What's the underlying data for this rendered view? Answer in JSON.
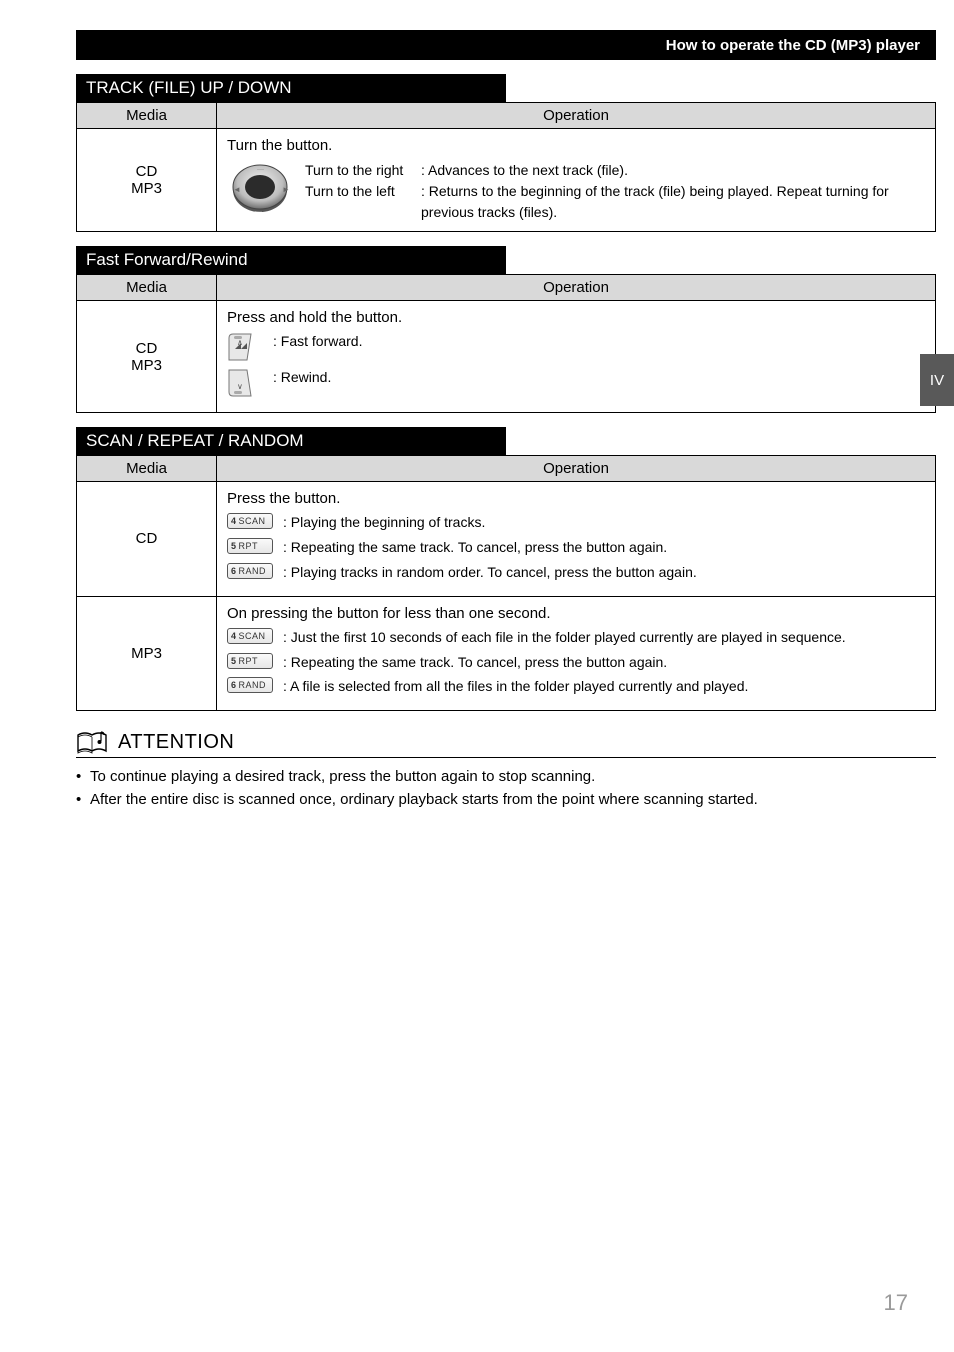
{
  "sideTab": "IV",
  "header": {
    "title": "How to operate the CD (MP3) player"
  },
  "section1": {
    "title": "TRACK (FILE) UP / DOWN",
    "mediaHeader": "Media",
    "opHeader": "Operation",
    "media1": "CD",
    "media2": "MP3",
    "lead": "Turn the button.",
    "rightLbl": "Turn to the right",
    "rightTxt": ": Advances to the next track (file).",
    "leftLbl": "Turn to the left",
    "leftTxt": ": Returns to the beginning of the track (file) being played. Repeat turning for previous tracks (files)."
  },
  "section2": {
    "title": "Fast Forward/Rewind",
    "mediaHeader": "Media",
    "opHeader": "Operation",
    "media1": "CD",
    "media2": "MP3",
    "lead": "Press and hold the button.",
    "ffTxt": ": Fast forward.",
    "rwTxt": ": Rewind."
  },
  "section3": {
    "title": "SCAN / REPEAT / RANDOM",
    "mediaHeader": "Media",
    "opHeader": "Operation",
    "cdMedia": "CD",
    "cdLead": "Press the button.",
    "cdScan": ": Playing the beginning of tracks.",
    "cdRpt": ": Repeating the same track. To cancel, press the button again.",
    "cdRand": ": Playing tracks in random order. To cancel, press the button again.",
    "mp3Media": "MP3",
    "mp3Lead": "On pressing the button for less than one second.",
    "mp3Scan": ": Just the first 10 seconds of each file in the folder played currently are played in sequence.",
    "mp3Rpt": ": Repeating the same track. To cancel, press the button again.",
    "mp3Rand": ": A file is selected from all the files in the folder played currently and played.",
    "keys": {
      "scanNum": "4",
      "scanLbl": "SCAN",
      "rptNum": "5",
      "rptLbl": "RPT",
      "randNum": "6",
      "randLbl": "RAND"
    }
  },
  "attention": {
    "title": "ATTENTION",
    "li1": "To continue playing a desired track, press the button again to stop scanning.",
    "li2": "After the entire disc is scanned once, ordinary playback starts from the point where scanning started."
  },
  "pageNumber": "17"
}
